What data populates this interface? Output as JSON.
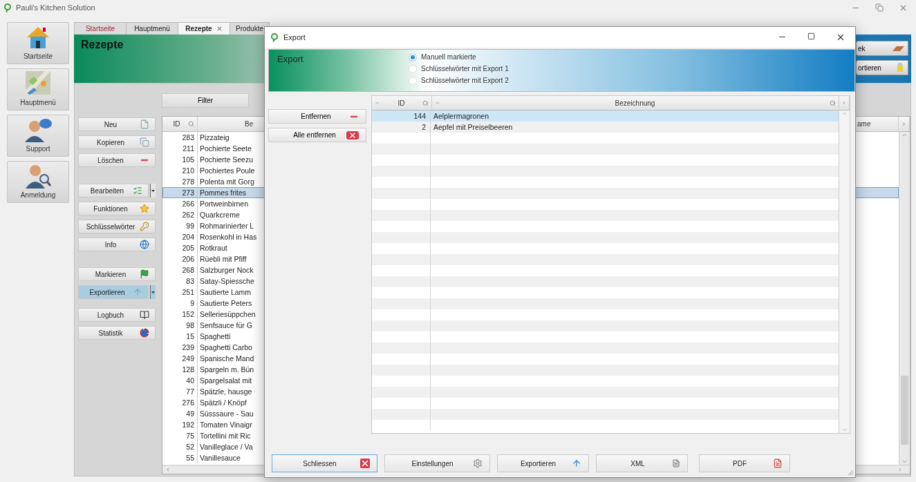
{
  "app": {
    "title": "Pauli's Kitchen Solution"
  },
  "nav": [
    {
      "label": "Startseite"
    },
    {
      "label": "Hauptmenü"
    },
    {
      "label": "Support"
    },
    {
      "label": "Anmeldung"
    }
  ],
  "tabs": [
    {
      "label": "Startseite",
      "kind": "home",
      "selected": false,
      "closable": false
    },
    {
      "label": "Hauptmenü",
      "kind": "page",
      "selected": false,
      "closable": false
    },
    {
      "label": "Rezepte",
      "kind": "page",
      "selected": true,
      "closable": true
    },
    {
      "label": "Produkte",
      "kind": "page",
      "selected": false,
      "closable": false
    }
  ],
  "page": {
    "title": "Rezepte",
    "filter_button": "Filter",
    "right_buttons": [
      "ek",
      "ortieren"
    ]
  },
  "actions": [
    [
      {
        "label": "Neu",
        "has_menu": false,
        "highlighted": false
      },
      {
        "label": "Kopieren",
        "has_menu": false,
        "highlighted": false
      },
      {
        "label": "Löschen",
        "has_menu": false,
        "highlighted": false
      }
    ],
    [
      {
        "label": "Bearbeiten",
        "has_menu": true,
        "highlighted": false
      },
      {
        "label": "Funktionen",
        "has_menu": false,
        "highlighted": false
      },
      {
        "label": "Schlüsselwörter",
        "has_menu": false,
        "highlighted": false
      },
      {
        "label": "Info",
        "has_menu": false,
        "highlighted": false
      }
    ],
    [
      {
        "label": "Markieren",
        "has_menu": false,
        "highlighted": false
      },
      {
        "label": "Exportieren",
        "has_menu": true,
        "highlighted": true
      }
    ],
    [
      {
        "label": "Logbuch",
        "has_menu": false,
        "highlighted": false
      },
      {
        "label": "Statistik",
        "has_menu": false,
        "highlighted": false
      }
    ]
  ],
  "recipes": {
    "columns": [
      "ID",
      "Be",
      "ame"
    ],
    "rows": [
      {
        "id": "283",
        "name": "Pizzateig",
        "selected": false
      },
      {
        "id": "211",
        "name": "Pochierte Seete",
        "selected": false
      },
      {
        "id": "105",
        "name": "Pochierte Seezu",
        "selected": false
      },
      {
        "id": "210",
        "name": "Pochiertes Poule",
        "selected": false
      },
      {
        "id": "278",
        "name": "Polenta mit Gorg",
        "selected": false
      },
      {
        "id": "273",
        "name": "Pommes frites",
        "selected": true
      },
      {
        "id": "266",
        "name": "Portweinbirnen",
        "selected": false
      },
      {
        "id": "262",
        "name": "Quarkcreme",
        "selected": false
      },
      {
        "id": "99",
        "name": "Rohmarinierter L",
        "selected": false
      },
      {
        "id": "204",
        "name": "Rosenkohl in Has",
        "selected": false
      },
      {
        "id": "205",
        "name": "Rotkraut",
        "selected": false
      },
      {
        "id": "206",
        "name": "Rüebli mit Pfiff",
        "selected": false
      },
      {
        "id": "268",
        "name": "Salzburger Nock",
        "selected": false
      },
      {
        "id": "83",
        "name": "Satay-Spiessche",
        "selected": false
      },
      {
        "id": "251",
        "name": "Sautierte Lamm",
        "selected": false
      },
      {
        "id": "9",
        "name": "Sautierte Peters",
        "selected": false
      },
      {
        "id": "152",
        "name": "Selleriesüppchen",
        "selected": false
      },
      {
        "id": "98",
        "name": "Senfsauce für G",
        "selected": false
      },
      {
        "id": "15",
        "name": "Spaghetti",
        "selected": false
      },
      {
        "id": "239",
        "name": "Spaghetti Carbo",
        "selected": false
      },
      {
        "id": "249",
        "name": "Spanische Mand",
        "selected": false
      },
      {
        "id": "128",
        "name": "Spargeln m. Bün",
        "selected": false
      },
      {
        "id": "40",
        "name": "Spargelsalat mit",
        "selected": false
      },
      {
        "id": "77",
        "name": "Spätzle, hausge",
        "selected": false
      },
      {
        "id": "276",
        "name": "Spätzli / Knöpf",
        "selected": false
      },
      {
        "id": "49",
        "name": "Süsssaure - Sau",
        "selected": false
      },
      {
        "id": "192",
        "name": "Tomaten Vinaigr",
        "selected": false
      },
      {
        "id": "75",
        "name": "Tortellini mit Ric",
        "selected": false
      },
      {
        "id": "52",
        "name": "Vanilleglace / Va",
        "selected": false
      },
      {
        "id": "55",
        "name": "Vanillesauce",
        "selected": false
      }
    ]
  },
  "dialog": {
    "title": "Export",
    "header": "Export",
    "options": [
      {
        "label": "Manuell markierte",
        "selected": true
      },
      {
        "label": "Schlüsselwörter mit Export 1",
        "selected": false
      },
      {
        "label": "Schlüsselwörter mit Export 2",
        "selected": false
      }
    ],
    "side_buttons": [
      "Entfernen",
      "Alle entfernen"
    ],
    "table": {
      "columns": [
        "ID",
        "Bezeichnung"
      ],
      "rows": [
        {
          "id": "144",
          "name": "Aelplermagronen",
          "selected": true
        },
        {
          "id": "2",
          "name": "Aepfel mit Preiselbeeren",
          "selected": false
        }
      ]
    },
    "footer_buttons": [
      {
        "label": "Schliessen",
        "focused": true
      },
      {
        "label": "Einstellungen",
        "focused": false
      },
      {
        "label": "Exportieren",
        "focused": false
      },
      {
        "label": "XML",
        "focused": false
      },
      {
        "label": "PDF",
        "focused": false
      }
    ]
  }
}
